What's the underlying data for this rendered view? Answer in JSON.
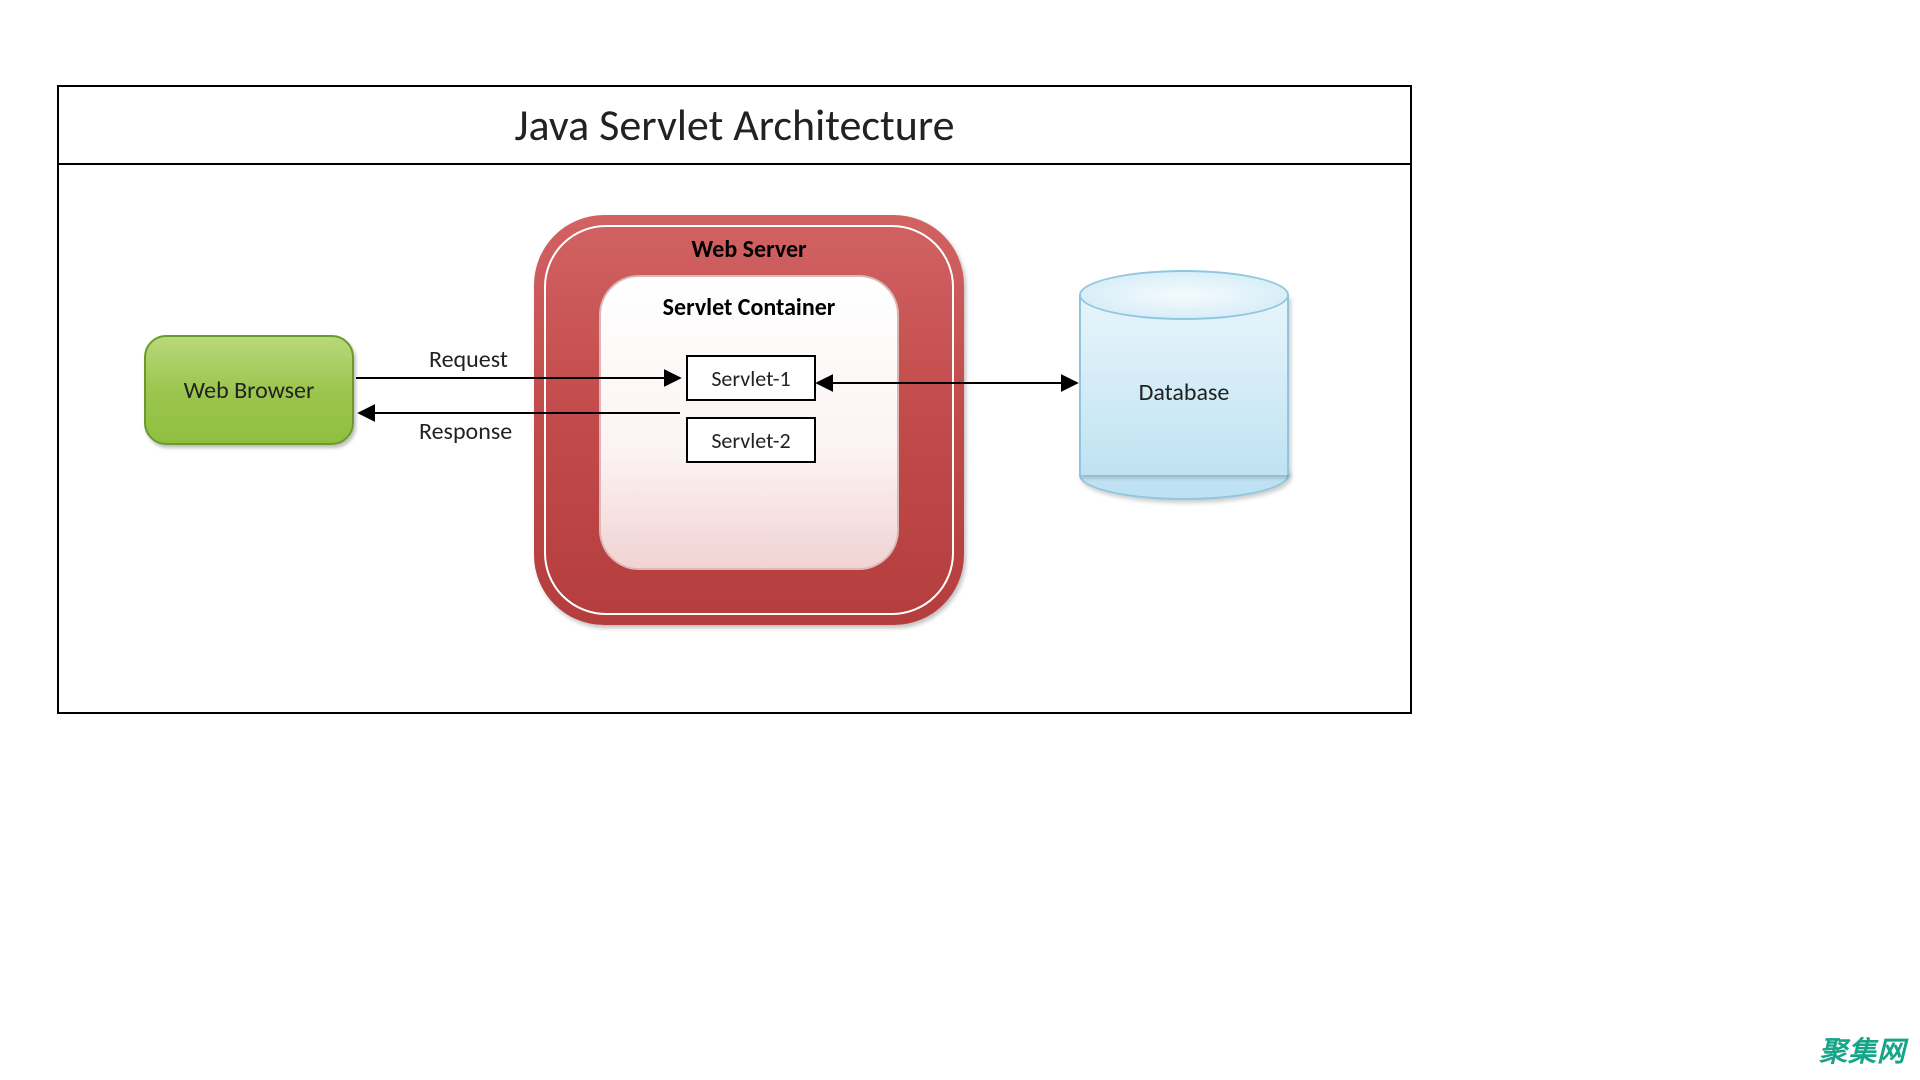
{
  "title": "Java Servlet Architecture",
  "browser": {
    "label": "Web Browser"
  },
  "server": {
    "label": "Web Server"
  },
  "container": {
    "label": "Servlet Container",
    "servlets": [
      "Servlet-1",
      "Servlet-2"
    ]
  },
  "database": {
    "label": "Database"
  },
  "arrows": {
    "request": "Request",
    "response": "Response"
  },
  "watermark": "聚集网",
  "colors": {
    "browser": "#9cc64f",
    "server": "#c24a4a",
    "database": "#d4ecf7",
    "arrow": "#000000"
  }
}
